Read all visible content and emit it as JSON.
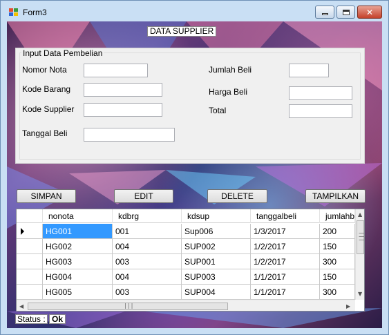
{
  "window": {
    "title": "Form3",
    "minimize_icon": "minimize-icon",
    "maximize_icon": "maximize-icon",
    "close_icon": "close-icon",
    "close_glyph": "✕"
  },
  "header": {
    "title": "DATA SUPPLIER"
  },
  "form": {
    "group_title": "Input Data Pembelian",
    "nomor_nota_label": "Nomor Nota",
    "kode_barang_label": "Kode Barang",
    "kode_supplier_label": "Kode Supplier",
    "tanggal_beli_label": "Tanggal Beli",
    "jumlah_beli_label": "Jumlah Beli",
    "harga_beli_label": "Harga Beli",
    "total_label": "Total",
    "nomor_nota_value": "",
    "kode_barang_value": "",
    "kode_supplier_value": "",
    "tanggal_beli_value": "",
    "jumlah_beli_value": "",
    "harga_beli_value": "",
    "total_value": ""
  },
  "buttons": {
    "simpan": "SIMPAN",
    "edit": "EDIT",
    "delete": "DELETE",
    "tampilkan": "TAMPILKAN"
  },
  "grid": {
    "columns": [
      "nonota",
      "kdbrg",
      "kdsup",
      "tanggalbeli",
      "jumlahbe"
    ],
    "rows": [
      [
        "HG001",
        "001",
        "Sup006",
        "1/3/2017",
        "200"
      ],
      [
        "HG002",
        "004",
        "SUP002",
        "1/2/2017",
        "150"
      ],
      [
        "HG003",
        "003",
        "SUP001",
        "1/2/2017",
        "300"
      ],
      [
        "HG004",
        "004",
        "SUP003",
        "1/1/2017",
        "150"
      ],
      [
        "HG005",
        "003",
        "SUP004",
        "1/1/2017",
        "300"
      ]
    ],
    "selected_row": 0,
    "current_row_icon": "current-row-arrow-icon",
    "scroll_up_glyph": "▲",
    "scroll_down_glyph": "▼",
    "scroll_left_glyph": "◀",
    "scroll_right_glyph": "▶",
    "grip_glyph": "|||"
  },
  "status": {
    "label": "Status :",
    "value": "Ok"
  },
  "colors": {
    "selection": "#3399ff",
    "window_frame": "#c9dff4",
    "close_button": "#c5412b"
  }
}
